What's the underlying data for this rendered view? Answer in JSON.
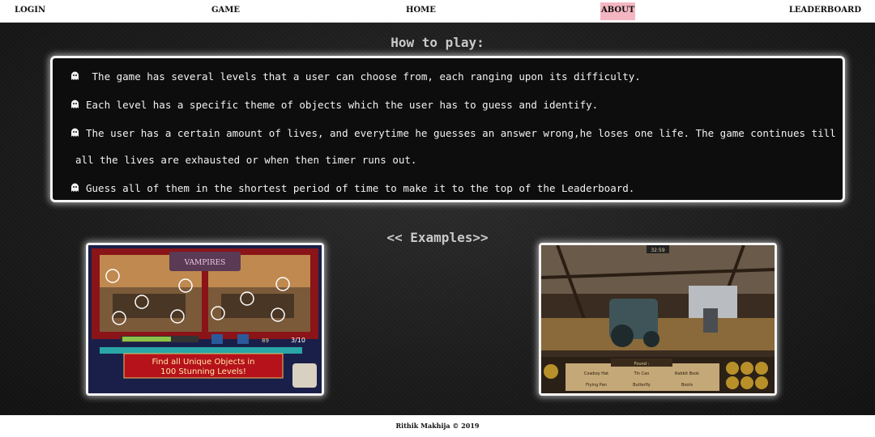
{
  "nav": {
    "items": [
      {
        "label": "LOGIN"
      },
      {
        "label": "GAME"
      },
      {
        "label": "HOME"
      },
      {
        "label": "ABOUT"
      },
      {
        "label": "LEADERBOARD"
      }
    ],
    "active_item": "ABOUT",
    "active_color": "#f4b6c2"
  },
  "how_to_play": {
    "title": "How to play:",
    "rules": [
      " The game has several levels that a user can choose from, each ranging upon its difficulty.",
      "Each level has a specific theme of objects which the user has to guess and identify.",
      "The user has a certain amount of lives, and everytime he guesses an answer wrong,he loses one life. The game continues till",
      "all the lives are exhausted or when then timer runs out.",
      "Guess all of them in the shortest period of time to make it to the top of the Leaderboard."
    ],
    "bullet_icon": "ghost-icon"
  },
  "examples": {
    "title": "<< Examples>>",
    "example_1": {
      "logo": "VAMPIRES",
      "counter": "3/10",
      "level": "89",
      "banner_line_1": "Find all Unique Objects in",
      "banner_line_2": "100 Stunning Levels!"
    },
    "example_2": {
      "timer": "32:59",
      "found_label": "Found :",
      "items": [
        "Cowboy Hat",
        "Tin Can",
        "Rabbit Book",
        "Frying Pan",
        "Butterfly",
        "Boots"
      ]
    }
  },
  "footer": {
    "text": "Rithik Makhija © 2019"
  },
  "colors": {
    "background_dark": "#1c1c1c",
    "panel_border": "#f4f4f4",
    "text_light": "#f2f2f2",
    "title_grey": "#c9c9c9"
  }
}
